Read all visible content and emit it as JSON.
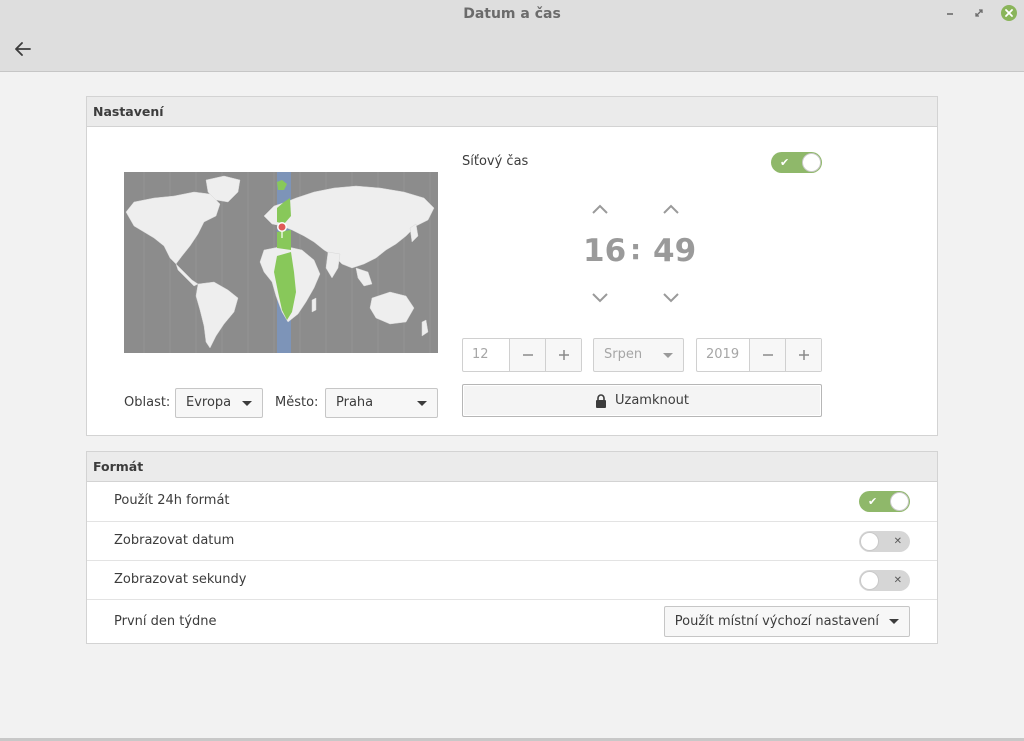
{
  "window": {
    "title": "Datum a čas"
  },
  "settings": {
    "heading": "Nastavení",
    "region_label": "Oblast:",
    "region_value": "Evropa",
    "city_label": "Město:",
    "city_value": "Praha",
    "network_time_label": "Síťový čas",
    "network_time_on": true,
    "hour": "16",
    "separator": ":",
    "minute": "49",
    "day": "12",
    "month": "Srpen",
    "year": "2019",
    "lock_label": "Uzamknout"
  },
  "format": {
    "heading": "Formát",
    "use_24h_label": "Použít 24h formát",
    "use_24h_on": true,
    "show_date_label": "Zobrazovat datum",
    "show_date_on": false,
    "show_seconds_label": "Zobrazovat sekundy",
    "show_seconds_on": false,
    "first_day_label": "První den týdne",
    "first_day_value": "Použít místní výchozí nastavení"
  },
  "icons": {
    "back": "arrow-left-icon",
    "minimize": "minimize-icon",
    "maximize": "maximize-icon",
    "close": "close-icon",
    "lock": "lock-icon",
    "check": "check-icon",
    "x": "x-icon",
    "up": "chevron-up-icon",
    "down": "chevron-down-icon",
    "plus": "plus-icon",
    "minus": "minus-icon",
    "pin": "location-pin-icon"
  },
  "colors": {
    "accent": "#8fb86a",
    "close_button": "#8ab55a",
    "map_ocean": "#8c8c8c",
    "map_land": "#eeeeee",
    "timezone_band": "#7d94b8",
    "timezone_land": "#88c85a",
    "pin": "#e05a5a"
  }
}
